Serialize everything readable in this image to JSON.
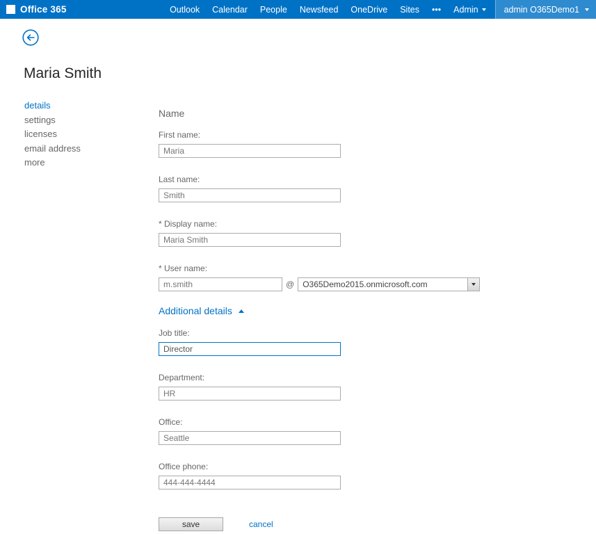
{
  "header": {
    "brand": "Office 365",
    "nav": [
      {
        "label": "Outlook"
      },
      {
        "label": "Calendar"
      },
      {
        "label": "People"
      },
      {
        "label": "Newsfeed"
      },
      {
        "label": "OneDrive"
      },
      {
        "label": "Sites"
      },
      {
        "label": "•••"
      }
    ],
    "admin_label": "Admin",
    "account_label": "admin O365Demo1"
  },
  "page": {
    "title": "Maria Smith"
  },
  "sidebar": {
    "items": [
      {
        "label": "details"
      },
      {
        "label": "settings"
      },
      {
        "label": "licenses"
      },
      {
        "label": "email address"
      },
      {
        "label": "more"
      }
    ]
  },
  "form": {
    "section_heading": "Name",
    "first_name": {
      "label": "First name:",
      "value": "Maria"
    },
    "last_name": {
      "label": "Last name:",
      "value": "Smith"
    },
    "display_name": {
      "label": "* Display name:",
      "value": "Maria Smith"
    },
    "user_name": {
      "label": "* User name:",
      "value": "m.smith",
      "separator": "@",
      "domain": "O365Demo2015.onmicrosoft.com"
    },
    "additional_details_label": "Additional details",
    "job_title": {
      "label": "Job title:",
      "value": "Director"
    },
    "department": {
      "label": "Department:",
      "value": "HR"
    },
    "office": {
      "label": "Office:",
      "value": "Seattle"
    },
    "office_phone": {
      "label": "Office phone:",
      "value": "444-444-4444"
    },
    "save_label": "save",
    "cancel_label": "cancel"
  },
  "colors": {
    "header_bg": "#0072c6",
    "accent": "#0072c6",
    "label_text": "#666666",
    "input_border": "#ababab",
    "input_text": "#767676"
  }
}
